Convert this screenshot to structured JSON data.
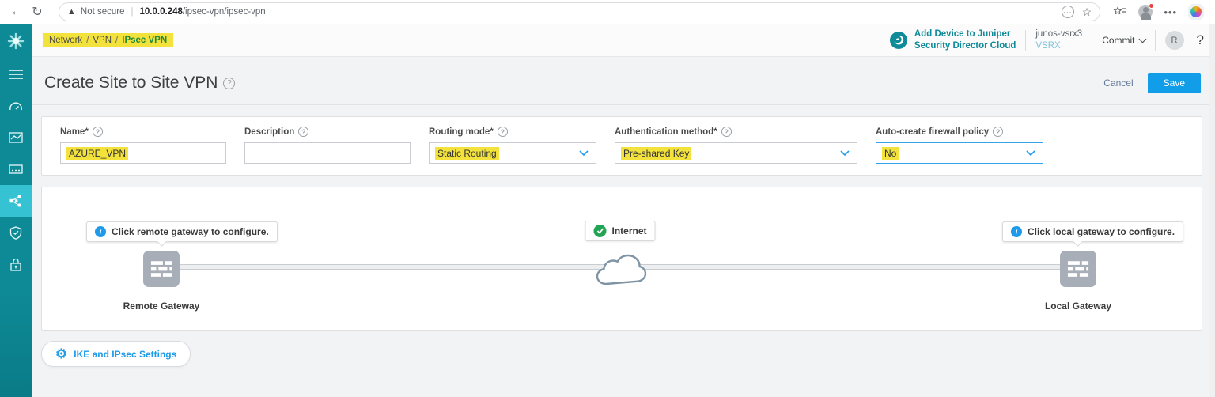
{
  "browser": {
    "back_icon": "arrow-left",
    "reload_icon": "reload",
    "security_label": "Not secure",
    "url_host": "10.0.0.248",
    "url_path": "/ipsec-vpn/ipsec-vpn",
    "pill_icons": [
      "reader-mode-dots",
      "favorite-star"
    ],
    "toolbar_icons": [
      "collections",
      "profile",
      "more-menu",
      "copilot"
    ]
  },
  "breadcrumb": {
    "items": [
      "Network",
      "VPN",
      "IPsec VPN"
    ],
    "separator": "/"
  },
  "header": {
    "juniper_logo": "juniper-cloud-logo",
    "add_device_line1": "Add Device to Juniper",
    "add_device_line2": "Security Director Cloud",
    "device_name": "junos-vsrx3",
    "device_model": "VSRX",
    "commit_label": "Commit",
    "avatar_initial": "R",
    "help_label": "?"
  },
  "sidebar": {
    "icons": [
      "juniper-flower-logo",
      "menu",
      "dashboard-gauge",
      "monitor-chart",
      "device-console",
      "network-share",
      "security-shield",
      "lock"
    ],
    "selected": "network-share"
  },
  "page": {
    "title": "Create Site to Site VPN",
    "cancel_label": "Cancel",
    "save_label": "Save"
  },
  "form": {
    "fields": [
      {
        "label": "Name*",
        "value": "AZURE_VPN",
        "type": "text"
      },
      {
        "label": "Description",
        "value": "",
        "type": "text"
      },
      {
        "label": "Routing mode*",
        "value": "Static Routing",
        "type": "select"
      },
      {
        "label": "Authentication method*",
        "value": "Pre-shared Key",
        "type": "select"
      },
      {
        "label": "Auto-create firewall policy",
        "value": "No",
        "type": "select-focused"
      }
    ]
  },
  "diagram": {
    "remote_tooltip": "Click remote gateway to configure.",
    "local_tooltip": "Click local gateway to configure.",
    "internet_label": "Internet",
    "remote_gateway_label": "Remote Gateway",
    "local_gateway_label": "Local Gateway"
  },
  "footer": {
    "ike_button_label": "IKE and IPsec Settings"
  },
  "colors": {
    "sidebar_teal": "#0d8a96",
    "sidebar_selected": "#35c3d4",
    "accent_blue": "#119de8",
    "link_blue": "#1d9bea",
    "highlight_yellow": "#f2e23b",
    "breadcrumb_active_green": "#1f8a3c",
    "check_green": "#23a455",
    "gateway_gray": "#a8aeb7"
  }
}
